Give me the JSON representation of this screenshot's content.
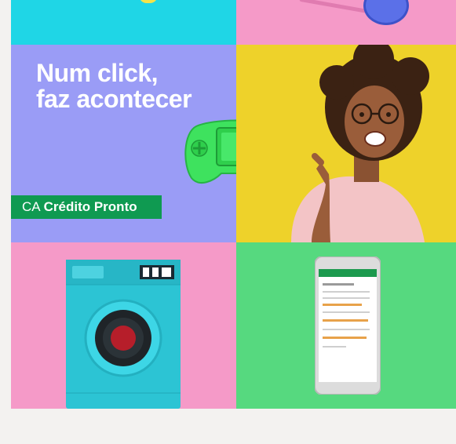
{
  "hero": {
    "headline_line1": "Num click,",
    "headline_line2": "faz acontecer"
  },
  "brand": {
    "prefix": "CA",
    "name": "Crédito Pronto"
  },
  "colors": {
    "cyan": "#1fd6e6",
    "pink": "#f59ac8",
    "violet": "#9a9cf6",
    "yellow": "#eed22a",
    "green": "#56d97f",
    "brand_green": "#0f9a51"
  },
  "icons": [
    "handheld-console-icon",
    "washing-machine-icon",
    "smartphone-icon",
    "toy-wheel-icon"
  ]
}
